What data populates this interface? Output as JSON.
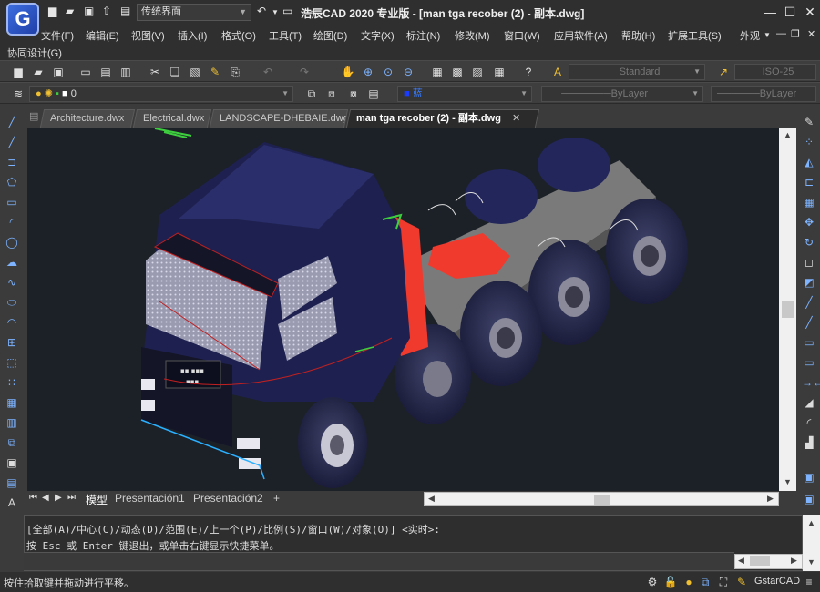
{
  "app": {
    "logo_letter": "G",
    "workspace": "传统界面",
    "title": "浩辰CAD 2020 专业版 - [man tga recober (2) - 副本.dwg]",
    "brand": "GstarCAD"
  },
  "menus": [
    "文件(F)",
    "编辑(E)",
    "视图(V)",
    "插入(I)",
    "格式(O)",
    "工具(T)",
    "绘图(D)",
    "文字(X)",
    "标注(N)",
    "修改(M)",
    "窗口(W)",
    "应用软件(A)",
    "帮助(H)",
    "扩展工具(S)",
    "外观"
  ],
  "menus_row2": [
    "协同设计(G)"
  ],
  "toolbar": {
    "text_style": "Standard",
    "dim_style": "ISO-25",
    "layer_name": "0",
    "color_value": "蓝",
    "linetype": "ByLayer",
    "lineweight": "ByLayer"
  },
  "doc_tabs": [
    {
      "label": "Architecture.dwx",
      "active": false
    },
    {
      "label": "Electrical.dwx",
      "active": false
    },
    {
      "label": "LANDSCAPE-DHEBAIE.dwg",
      "active": false
    },
    {
      "label": "man tga recober (2) - 副本.dwg",
      "active": true
    }
  ],
  "layout_tabs": [
    "模型",
    "Presentación1",
    "Presentación2",
    "+"
  ],
  "command": {
    "line1": "[全部(A)/中心(C)/动态(D)/范围(E)/上一个(P)/比例(S)/窗口(W)/对象(O)] <实时>:",
    "line2": "按 Esc 或 Enter 键退出，或单击右键显示快捷菜单。"
  },
  "status": {
    "text": "按住拾取键并拖动进行平移。"
  },
  "colors": {
    "truck_body": "#1e2150",
    "accent_red": "#f03a2e",
    "chassis": "#7a7a7a",
    "canvas_bg": "#1c2128"
  }
}
